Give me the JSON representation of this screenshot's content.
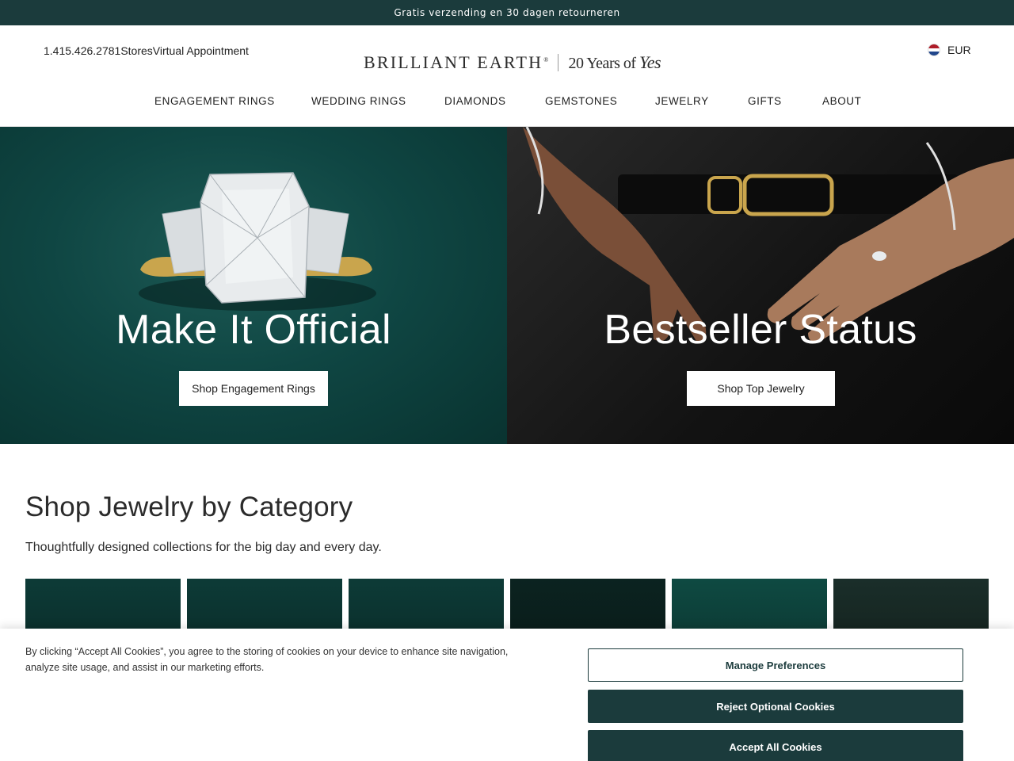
{
  "promo": {
    "text": "Gratis verzending en 30 dagen retourneren"
  },
  "header": {
    "phone": "1.415.426.2781",
    "stores": "Stores",
    "appointment": "Virtual Appointment",
    "logo_brand": "BRILLIANT EARTH",
    "logo_reg": "®",
    "logo_tagline_prefix": "20 Years of ",
    "logo_tagline_script": "Yes",
    "currency": "EUR",
    "flag_icon": "netherlands-flag-icon"
  },
  "nav": {
    "items": [
      {
        "label": "ENGAGEMENT RINGS"
      },
      {
        "label": "WEDDING RINGS"
      },
      {
        "label": "DIAMONDS"
      },
      {
        "label": "GEMSTONES"
      },
      {
        "label": "JEWELRY"
      },
      {
        "label": "GIFTS"
      },
      {
        "label": "ABOUT"
      }
    ]
  },
  "hero": {
    "left": {
      "title": "Make It Official",
      "button": "Shop Engagement Rings"
    },
    "right": {
      "title": "Bestseller Status",
      "button": "Shop Top Jewelry"
    }
  },
  "category": {
    "title": "Shop Jewelry by Category",
    "subtitle": "Thoughtfully designed collections for the big day and every day."
  },
  "cookie": {
    "text": "By clicking “Accept All Cookies”, you agree to the storing of cookies on your device to enhance site navigation, analyze site usage, and assist in our marketing efforts.",
    "manage": "Manage Preferences",
    "reject": "Reject Optional Cookies",
    "accept": "Accept All Cookies"
  },
  "colors": {
    "brand_dark": "#1b3b3c",
    "hero_teal": "#0f4643"
  }
}
